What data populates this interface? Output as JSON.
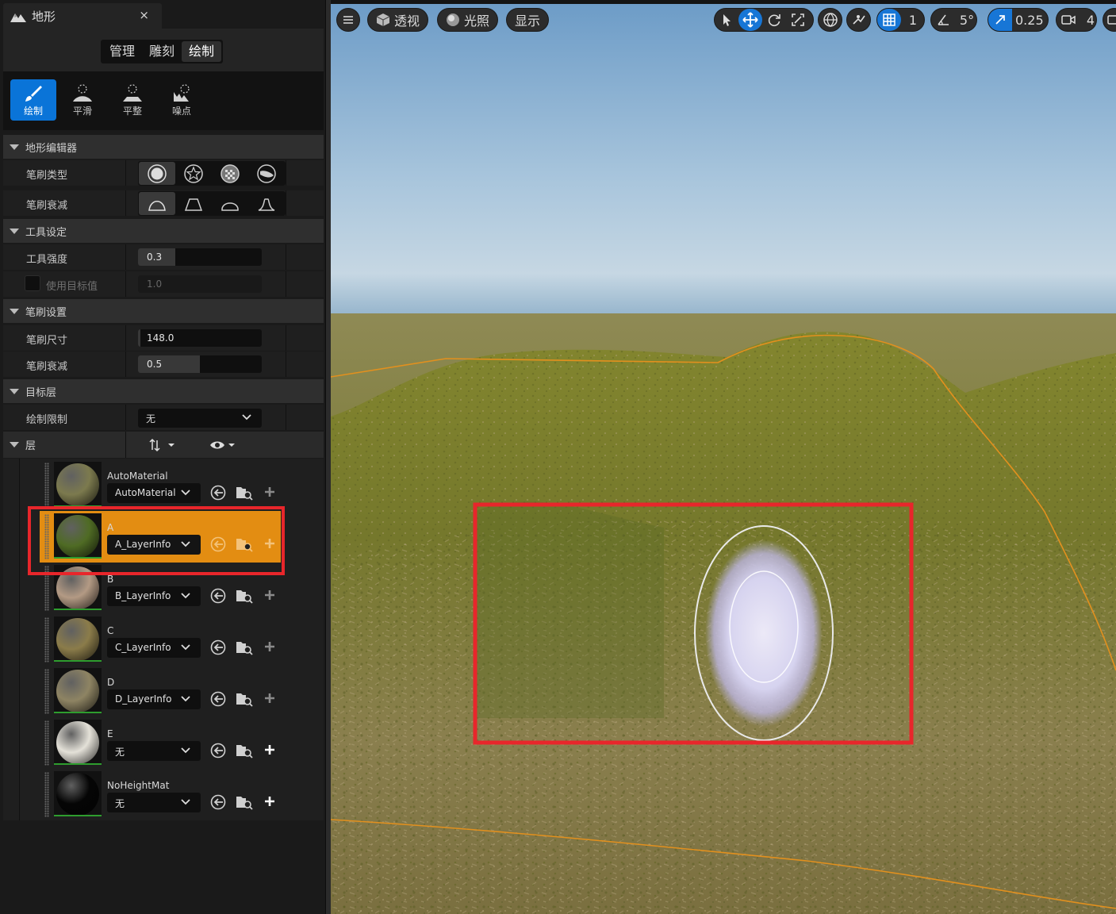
{
  "panel": {
    "tab_title": "地形",
    "close_glyph": "×",
    "modes": [
      "管理",
      "雕刻",
      "绘制"
    ],
    "active_mode": "绘制",
    "tools": [
      {
        "label": "绘制",
        "icon": "paint-brush-icon",
        "active": true
      },
      {
        "label": "平滑",
        "icon": "smooth-icon",
        "active": false
      },
      {
        "label": "平整",
        "icon": "flatten-icon",
        "active": false
      },
      {
        "label": "噪点",
        "icon": "noise-icon",
        "active": false
      }
    ],
    "sections": {
      "editor": "地形编辑器",
      "tool_settings": "工具设定",
      "brush_settings": "笔刷设置",
      "target_layers": "目标层",
      "layers": "层"
    },
    "brush_type_label": "笔刷类型",
    "brush_falloff_label": "笔刷衰减",
    "tool_strength": {
      "label": "工具强度",
      "value": "0.3",
      "fraction": 0.3
    },
    "use_target": {
      "label": "使用目标值",
      "value": "1.0",
      "checked": false
    },
    "brush_size": {
      "label": "笔刷尺寸",
      "value": "148.0",
      "fraction": 0.02
    },
    "brush_falloff": {
      "label": "笔刷衰减",
      "value": "0.5",
      "fraction": 0.5
    },
    "paint_limit": {
      "label": "绘制限制",
      "value": "无"
    }
  },
  "layers": [
    {
      "name": "AutoMaterial",
      "info": "AutoMaterial",
      "active": false,
      "color": "#7c7a4e"
    },
    {
      "name": "A",
      "info": "A_LayerInfo",
      "active": true,
      "color": "#4f6b24"
    },
    {
      "name": "B",
      "info": "B_LayerInfo",
      "active": false,
      "color": "#b39a84"
    },
    {
      "name": "C",
      "info": "C_LayerInfo",
      "active": false,
      "color": "#8b7c4a"
    },
    {
      "name": "D",
      "info": "D_LayerInfo",
      "active": false,
      "color": "#8e8463"
    },
    {
      "name": "E",
      "info": "无",
      "active": false,
      "color": "#e4e1d8"
    },
    {
      "name": "NoHeightMat",
      "info": "无",
      "active": false,
      "color": "#050505"
    }
  ],
  "viewport": {
    "perspective": "透视",
    "lighting": "光照",
    "show": "显示",
    "grid_snap": "1",
    "angle_snap": "5°",
    "scale_snap": "0.25",
    "camera_speed": "4",
    "accent": "#1776d6",
    "selection_color": "#e8262b",
    "landscape_border": "#e2901e"
  }
}
